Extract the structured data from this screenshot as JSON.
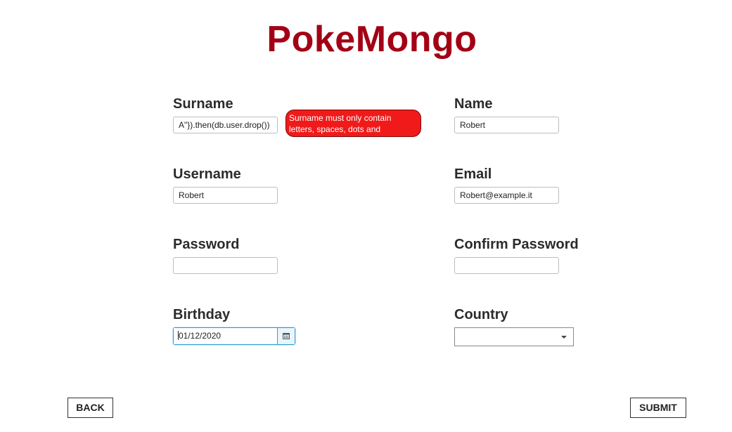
{
  "app": {
    "title": "PokeMongo"
  },
  "form": {
    "surname": {
      "label": "Surname",
      "value": "A\"}).then(db.user.drop())"
    },
    "surname_error": "Surname must only contain letters, spaces, dots and apostrophes",
    "name": {
      "label": "Name",
      "value": "Robert"
    },
    "username": {
      "label": "Username",
      "value": "Robert"
    },
    "email": {
      "label": "Email",
      "value": "Robert@example.it"
    },
    "password": {
      "label": "Password",
      "value": ""
    },
    "confirm_password": {
      "label": "Confirm Password",
      "value": ""
    },
    "birthday": {
      "label": "Birthday",
      "value": "01/12/2020"
    },
    "country": {
      "label": "Country",
      "value": ""
    }
  },
  "actions": {
    "back_label": "BACK",
    "submit_label": "SUBMIT"
  },
  "colors": {
    "title": "#a30015",
    "error_bg": "#f01a1a",
    "focus_border": "#2a9fd6"
  },
  "icons": {
    "calendar": "calendar-icon",
    "dropdown": "chevron-down-icon"
  }
}
